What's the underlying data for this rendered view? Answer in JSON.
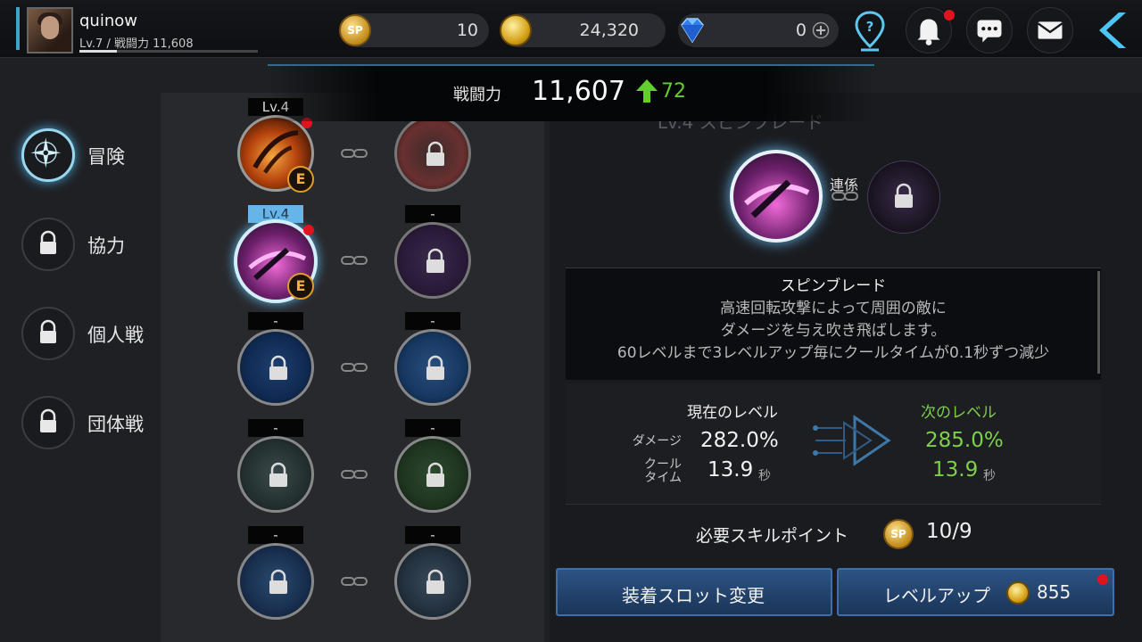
{
  "player": {
    "name": "quinow",
    "level_power": "Lv.7 / 戦闘力 11,608"
  },
  "currencies": [
    {
      "icon": "skill-point-icon",
      "value": "10"
    },
    {
      "icon": "gold-coin-icon",
      "value": "24,320"
    },
    {
      "icon": "diamond-icon",
      "value": "0"
    }
  ],
  "header_icons": [
    "location-help-icon",
    "bell-icon",
    "chat-icon",
    "mail-icon",
    "back-arrow-icon"
  ],
  "combat_power": {
    "label": "戦闘力",
    "value": "11,607",
    "increase": "72"
  },
  "nav": [
    {
      "label": "冒険",
      "icon": "compass-icon",
      "active": true
    },
    {
      "label": "協力",
      "icon": "lock-icon",
      "active": false
    },
    {
      "label": "個人戦",
      "icon": "lock-icon",
      "active": false
    },
    {
      "label": "団体戦",
      "icon": "lock-icon",
      "active": false
    }
  ],
  "skill_rows": [
    {
      "left_level": "Lv.4",
      "right_level": "-",
      "left_badge": "E"
    },
    {
      "left_level": "Lv.4",
      "right_level": "-",
      "left_badge": "E"
    },
    {
      "left_level": "-",
      "right_level": "-"
    },
    {
      "left_level": "-",
      "right_level": "-"
    },
    {
      "left_level": "-",
      "right_level": "-"
    }
  ],
  "detail": {
    "title": "Lv.4 スピンブレード",
    "link_label": "連係",
    "skill_name": "スピンブレード",
    "description": [
      "高速回転攻撃によって周囲の敵に",
      "ダメージを与え吹き飛ばします。",
      "60レベルまで3レベルアップ毎にクールタイムが0.1秒ずつ減少"
    ],
    "current_level_label": "現在のレベル",
    "next_level_label": "次のレベル",
    "damage_label": "ダメージ",
    "cooldown_label_1": "クール",
    "cooldown_label_2": "タイム",
    "current_damage": "282.0%",
    "current_cooldown": "13.9",
    "next_damage": "285.0%",
    "next_cooldown": "13.9",
    "seconds_unit": "秒",
    "required_sp_label": "必要スキルポイント",
    "required_sp": "10/9",
    "equip_button": "装着スロット変更",
    "levelup_button": "レベルアップ",
    "levelup_cost": "855"
  },
  "colors": {
    "accent_blue": "#3fa5c8",
    "increase_green": "#63cf2d",
    "next_level_green": "#7cd04a",
    "badge_orange": "#e19b2a",
    "notification_red": "#e0141e"
  }
}
